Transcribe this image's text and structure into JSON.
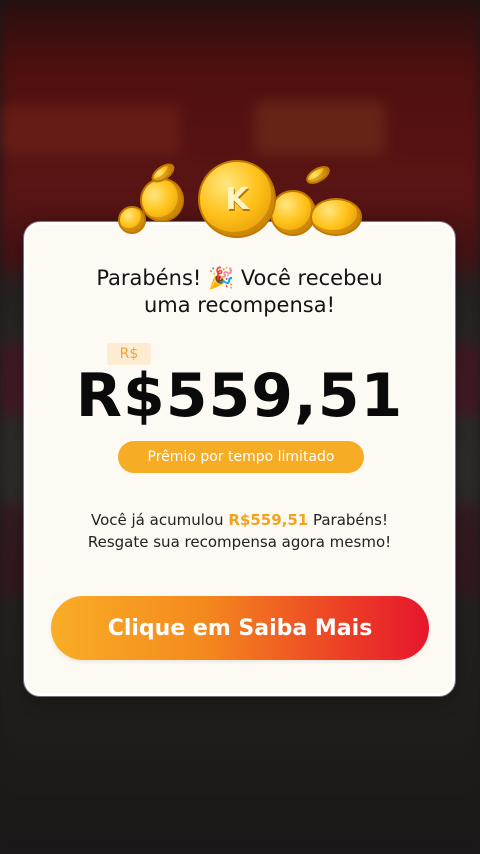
{
  "dialog": {
    "headline_line1": "Parabéns! 🎉 Você recebeu",
    "headline_line2": "uma recompensa!",
    "currency_tag": "R$",
    "amount": "R$559,51",
    "limited_label": "Prêmio por tempo limitado",
    "summary_prefix": "Você já acumulou ",
    "summary_amount": "R$559,51",
    "summary_suffix": " Parabéns!",
    "summary_line2": "Resgate sua recompensa agora mesmo!",
    "cta_label": "Clique em Saiba Mais",
    "coin_letter": "K"
  },
  "colors": {
    "accent_orange": "#f6ac24",
    "cta_start": "#f9ad26",
    "cta_end": "#e6162c",
    "highlight": "#f2a21d"
  }
}
